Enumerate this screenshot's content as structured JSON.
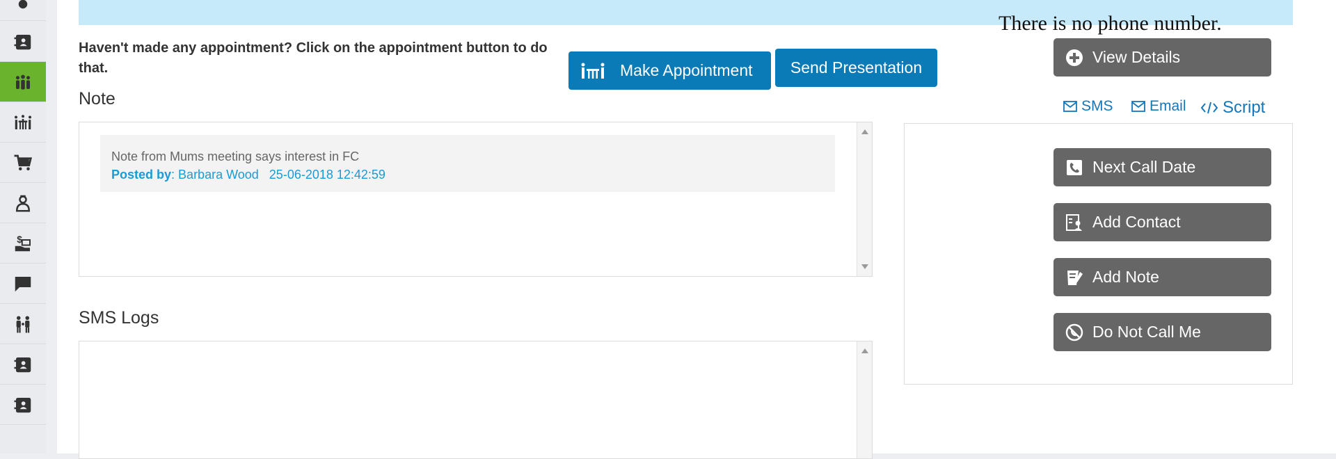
{
  "sidebar": {
    "items": [
      {
        "icon": "person-icon"
      },
      {
        "icon": "contact-book-icon"
      },
      {
        "icon": "group-icon",
        "active": true
      },
      {
        "icon": "meeting-table-icon"
      },
      {
        "icon": "cart-icon"
      },
      {
        "icon": "agent-icon"
      },
      {
        "icon": "payment-hand-icon"
      },
      {
        "icon": "chat-icon"
      },
      {
        "icon": "family-icon"
      },
      {
        "icon": "contact-book-icon"
      },
      {
        "icon": "contact-book-icon"
      }
    ],
    "active_color": "#6ab42d"
  },
  "banner": {
    "color": "#c6eaf9"
  },
  "tooltip": {
    "text": "There is no phone number.",
    "arrow_color": "#e00000"
  },
  "hint": {
    "text": "Haven't made any appointment? Click on the appointment button to do that."
  },
  "buttons": {
    "make_appointment": "Make Appointment",
    "send_presentation": "Send Presentation",
    "view_details": "View Details",
    "next_call_date": "Next Call Date",
    "add_contact": "Add Contact",
    "add_note": "Add Note",
    "do_not_call": "Do Not Call Me"
  },
  "links": {
    "sms": "SMS",
    "email": "Email",
    "script": "Script"
  },
  "note": {
    "title": "Note",
    "entries": [
      {
        "text": "Note from Mums meeting says interest in FC",
        "posted_by_label": "Posted by",
        "author": "Barbara Wood",
        "timestamp": "25-06-2018 12:42:59"
      }
    ]
  },
  "sms_logs": {
    "title": "SMS Logs"
  },
  "colors": {
    "primary_blue": "#0a7bb6",
    "gray_button": "#666666",
    "link_blue": "#1576b8"
  }
}
